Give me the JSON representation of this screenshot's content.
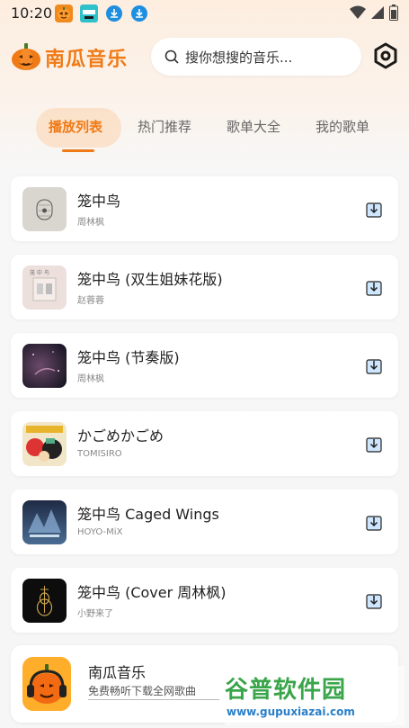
{
  "status_bar": {
    "time": "10:20"
  },
  "header": {
    "app_title": "南瓜音乐",
    "search_placeholder": "搜你想搜的音乐..."
  },
  "tabs": [
    {
      "label": "播放列表",
      "active": true
    },
    {
      "label": "热门推荐",
      "active": false
    },
    {
      "label": "歌单大全",
      "active": false
    },
    {
      "label": "我的歌单",
      "active": false
    }
  ],
  "songs": [
    {
      "title": "笼中鸟",
      "artist": "周林枫"
    },
    {
      "title": "笼中鸟 (双生姐妹花版)",
      "artist": "赵蓉蓉"
    },
    {
      "title": "笼中鸟 (节奏版)",
      "artist": "周林枫"
    },
    {
      "title": "かごめかごめ",
      "artist": "TOMISIRO"
    },
    {
      "title": "笼中鸟 Caged Wings",
      "artist": "HOYO-MiX"
    },
    {
      "title": "笼中鸟 (Cover 周林枫)",
      "artist": "小野来了"
    }
  ],
  "promo": {
    "title": "南瓜音乐",
    "subtitle": "免费畅听下载全网歌曲"
  },
  "watermark": {
    "name": "谷普软件园",
    "url": "www.gupuxiazai.com"
  },
  "colors": {
    "accent": "#f07a16",
    "background": "#f6f6f6"
  }
}
